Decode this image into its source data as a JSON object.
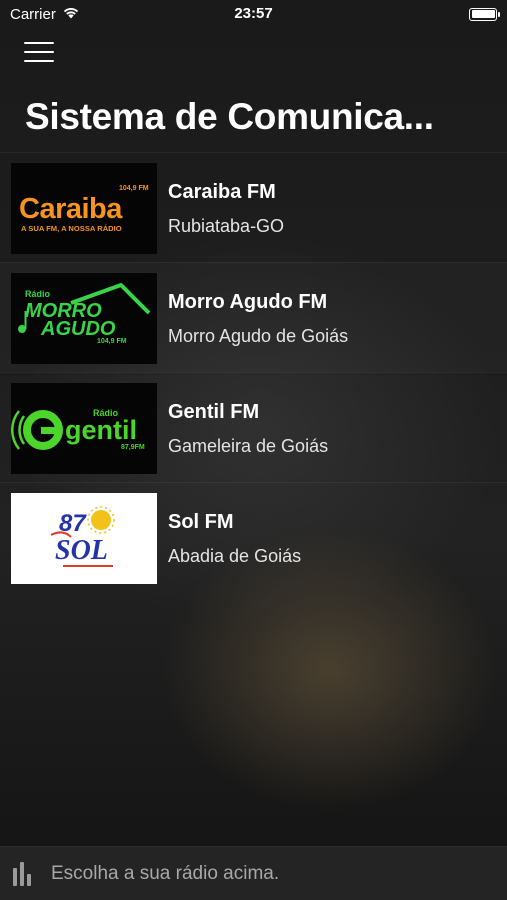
{
  "status_bar": {
    "carrier": "Carrier",
    "time": "23:57",
    "wifi_icon": "wifi-icon",
    "battery_icon": "battery-icon"
  },
  "header": {
    "menu_icon": "hamburger-menu-icon",
    "title": "Sistema de Comunica..."
  },
  "stations": [
    {
      "name": "Caraiba FM",
      "city": "Rubiataba-GO",
      "logo": {
        "text": "Caraiba",
        "freq": "104,9 FM",
        "slogan": "A SUA FM, A NOSSA RÁDIO",
        "color": "#f7941d"
      }
    },
    {
      "name": "Morro Agudo FM",
      "city": "Morro Agudo de Goiás",
      "logo": {
        "top": "Rádio",
        "line1": "MORRO",
        "line2": "AGUDO",
        "freq": "104,9 FM",
        "color": "#39d34a"
      }
    },
    {
      "name": "Gentil FM",
      "city": "Gameleira de Goiás",
      "logo": {
        "top": "Rádio",
        "text": "gentil",
        "freq": "87,9FM",
        "color": "#4cd52a"
      }
    },
    {
      "name": "Sol FM",
      "city": "Abadia de Goiás",
      "logo": {
        "number": "87",
        "text": "SOL",
        "color_primary": "#2433a6",
        "color_accent": "#f2c21a"
      }
    }
  ],
  "player": {
    "icon": "equalizer-bars-icon",
    "status_text": "Escolha a sua rádio acima."
  }
}
